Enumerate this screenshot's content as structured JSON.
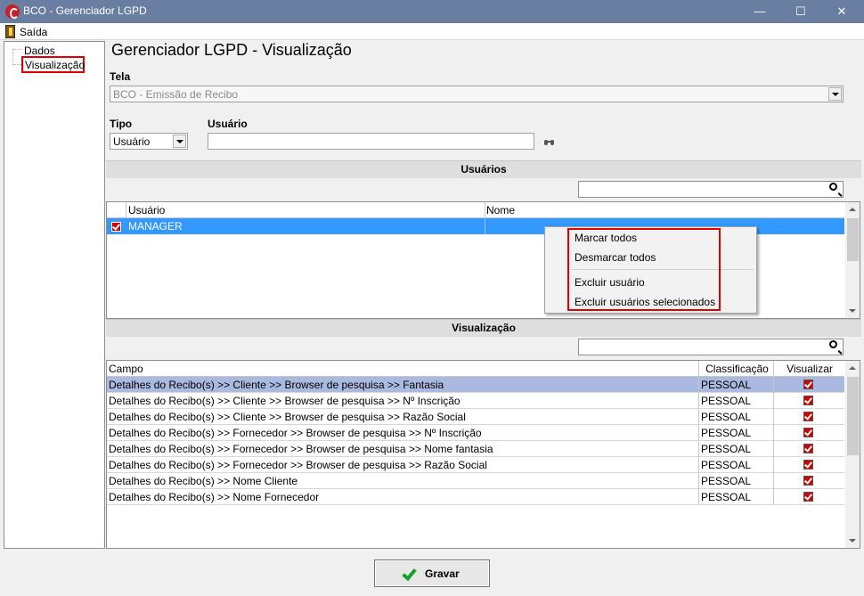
{
  "window": {
    "title": "BCO - Gerenciador LGPD",
    "minimize_glyph": "—",
    "maximize_glyph": "☐",
    "close_glyph": "✕"
  },
  "menubar": {
    "items": [
      "Saída"
    ]
  },
  "tree": {
    "items": [
      "Dados",
      "Visualização"
    ],
    "selected": "Visualização"
  },
  "main": {
    "title": "Gerenciador LGPD - Visualização",
    "tela_label": "Tela",
    "tela_value": "BCO - Emissão de Recibo",
    "tipo_label": "Tipo",
    "tipo_value": "Usuário",
    "usuario_label": "Usuário",
    "usuario_value": ""
  },
  "usuarios_section": {
    "header": "Usuários",
    "search_value": "",
    "columns": [
      "Usuário",
      "Nome"
    ],
    "rows": [
      {
        "checked": true,
        "usuario": "MANAGER",
        "nome": ""
      }
    ]
  },
  "context_menu": {
    "items": [
      "Marcar todos",
      "Desmarcar todos",
      "Excluir usuário",
      "Excluir usuários selecionados"
    ]
  },
  "visualizacao_section": {
    "header": "Visualização",
    "search_value": "",
    "columns": [
      "Campo",
      "Classificação",
      "Visualizar"
    ],
    "rows": [
      {
        "campo": "Detalhes do Recibo(s) >> Cliente >> Browser de pesquisa >> Fantasia",
        "classificacao": "PESSOAL",
        "visualizar": true
      },
      {
        "campo": "Detalhes do Recibo(s) >> Cliente >> Browser de pesquisa >> Nº Inscrição",
        "classificacao": "PESSOAL",
        "visualizar": true
      },
      {
        "campo": "Detalhes do Recibo(s) >> Cliente >> Browser de pesquisa >> Razão Social",
        "classificacao": "PESSOAL",
        "visualizar": true
      },
      {
        "campo": "Detalhes do Recibo(s) >> Fornecedor >> Browser de pesquisa >> Nº Inscrição",
        "classificacao": "PESSOAL",
        "visualizar": true
      },
      {
        "campo": "Detalhes do Recibo(s) >> Fornecedor >> Browser de pesquisa >> Nome fantasia",
        "classificacao": "PESSOAL",
        "visualizar": true
      },
      {
        "campo": "Detalhes do Recibo(s) >> Fornecedor >> Browser de pesquisa >> Razão Social",
        "classificacao": "PESSOAL",
        "visualizar": true
      },
      {
        "campo": "Detalhes do Recibo(s) >> Nome Cliente",
        "classificacao": "PESSOAL",
        "visualizar": true
      },
      {
        "campo": "Detalhes do Recibo(s) >> Nome Fornecedor",
        "classificacao": "PESSOAL",
        "visualizar": true
      }
    ]
  },
  "footer": {
    "save_label": "Gravar"
  },
  "colors": {
    "titlebar": "#6a7ea1",
    "selection": "#3399ff",
    "row_highlight": "#aab9e0",
    "annotation": "#e00000"
  }
}
